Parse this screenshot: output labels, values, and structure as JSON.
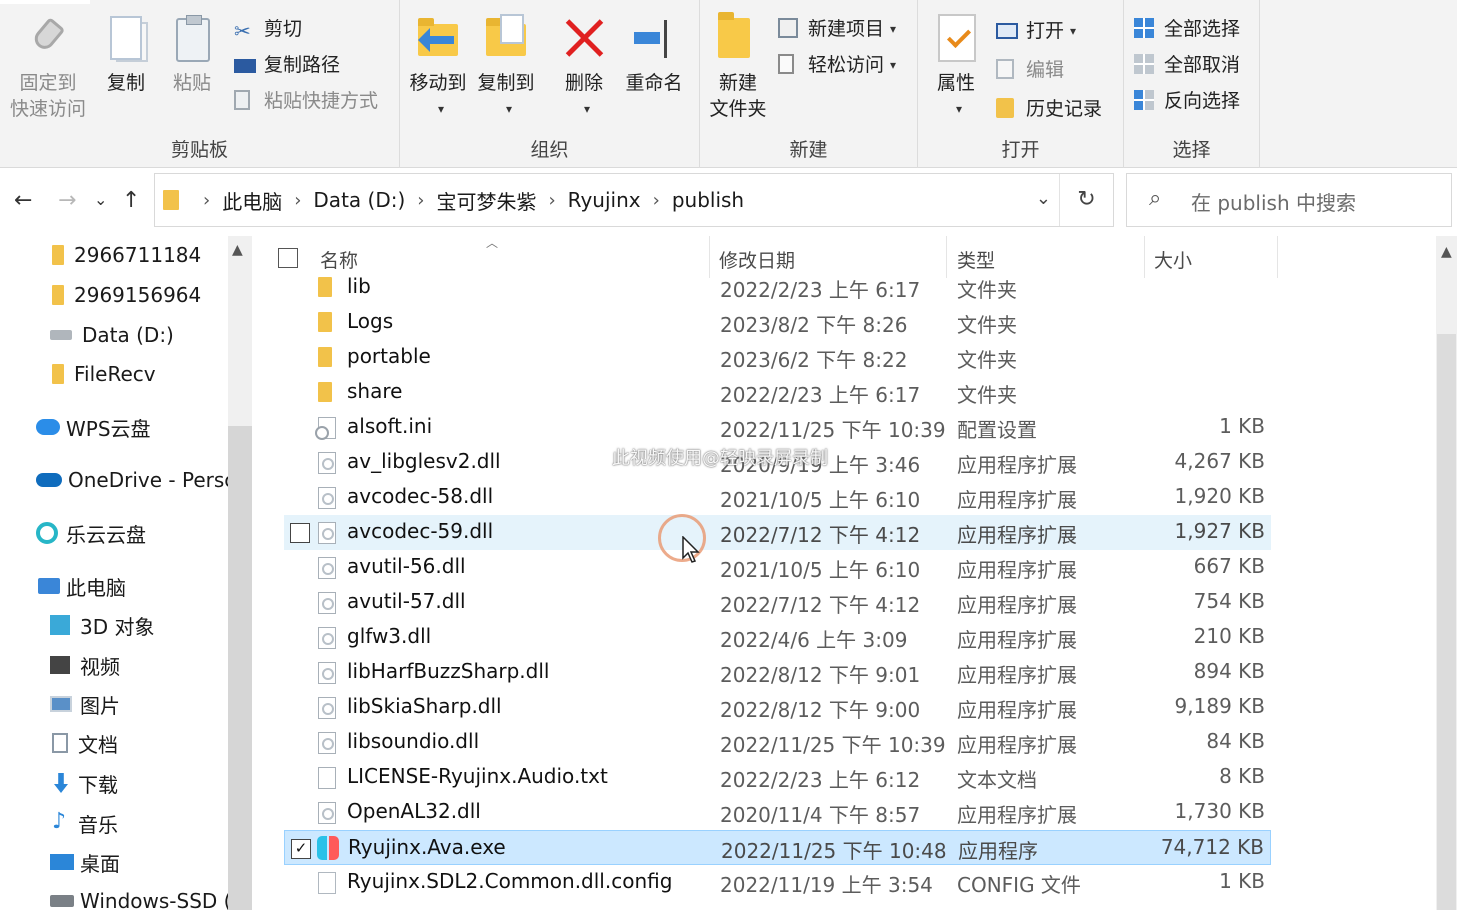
{
  "ribbon": {
    "clipboard": {
      "pin_label_1": "固定到",
      "pin_label_2": "快速访问",
      "copy": "复制",
      "paste": "粘贴",
      "cut": "剪切",
      "copy_path": "复制路径",
      "paste_shortcut": "粘贴快捷方式",
      "group": "剪贴板"
    },
    "organize": {
      "move_to": "移动到",
      "copy_to": "复制到",
      "delete": "删除",
      "rename": "重命名",
      "group": "组织"
    },
    "new": {
      "new_folder_1": "新建",
      "new_folder_2": "文件夹",
      "new_item": "新建项目",
      "easy_access": "轻松访问",
      "group": "新建"
    },
    "open": {
      "properties": "属性",
      "open": "打开",
      "edit": "编辑",
      "history": "历史记录",
      "group": "打开"
    },
    "select": {
      "select_all": "全部选择",
      "select_none": "全部取消",
      "invert": "反向选择",
      "group": "选择"
    }
  },
  "nav": {
    "back": "←",
    "forward": "→",
    "recent": "⌄",
    "up": "↑",
    "breadcrumbs": [
      "此电脑",
      "Data (D:)",
      "宝可梦朱紫",
      "Ryujinx",
      "publish"
    ],
    "refresh": "↻",
    "search_placeholder": "在 publish 中搜索"
  },
  "sidebar": {
    "items": [
      {
        "label": "2966711184",
        "icon": "folder-icon"
      },
      {
        "label": "2969156964",
        "icon": "folder-icon"
      },
      {
        "label": "Data (D:)",
        "icon": "drive-icon"
      },
      {
        "label": "FileRecv",
        "icon": "folder-icon"
      },
      {
        "label": "WPS云盘",
        "icon": "cloud-icon"
      },
      {
        "label": "OneDrive - Persc",
        "icon": "onedrive-icon"
      },
      {
        "label": "乐云云盘",
        "icon": "cloud-ring-icon"
      },
      {
        "label": "此电脑",
        "icon": "computer-icon"
      },
      {
        "label": "3D 对象",
        "icon": "cube-icon"
      },
      {
        "label": "视频",
        "icon": "video-icon"
      },
      {
        "label": "图片",
        "icon": "picture-icon"
      },
      {
        "label": "文档",
        "icon": "document-icon"
      },
      {
        "label": "下载",
        "icon": "download-icon"
      },
      {
        "label": "音乐",
        "icon": "music-icon"
      },
      {
        "label": "桌面",
        "icon": "desktop-icon"
      },
      {
        "label": "Windows-SSD (",
        "icon": "drive-icon"
      }
    ]
  },
  "columns": {
    "name": "名称",
    "date": "修改日期",
    "type": "类型",
    "size": "大小"
  },
  "files": [
    {
      "name": "lib",
      "date": "2022/2/23 上午 6:17",
      "type": "文件夹",
      "size": "",
      "kind": "folder"
    },
    {
      "name": "Logs",
      "date": "2023/8/2 下午 8:26",
      "type": "文件夹",
      "size": "",
      "kind": "folder"
    },
    {
      "name": "portable",
      "date": "2023/6/2 下午 8:22",
      "type": "文件夹",
      "size": "",
      "kind": "folder"
    },
    {
      "name": "share",
      "date": "2022/2/23 上午 6:17",
      "type": "文件夹",
      "size": "",
      "kind": "folder"
    },
    {
      "name": "alsoft.ini",
      "date": "2022/11/25 下午 10:39",
      "type": "配置设置",
      "size": "1 KB",
      "kind": "ini"
    },
    {
      "name": "av_libglesv2.dll",
      "date": "2020/9/19 上午 3:46",
      "type": "应用程序扩展",
      "size": "4,267 KB",
      "kind": "dll"
    },
    {
      "name": "avcodec-58.dll",
      "date": "2021/10/5 上午 6:10",
      "type": "应用程序扩展",
      "size": "1,920 KB",
      "kind": "dll"
    },
    {
      "name": "avcodec-59.dll",
      "date": "2022/7/12 下午 4:12",
      "type": "应用程序扩展",
      "size": "1,927 KB",
      "kind": "dll",
      "state": "hover"
    },
    {
      "name": "avutil-56.dll",
      "date": "2021/10/5 上午 6:10",
      "type": "应用程序扩展",
      "size": "667 KB",
      "kind": "dll"
    },
    {
      "name": "avutil-57.dll",
      "date": "2022/7/12 下午 4:12",
      "type": "应用程序扩展",
      "size": "754 KB",
      "kind": "dll"
    },
    {
      "name": "glfw3.dll",
      "date": "2022/4/6 上午 3:09",
      "type": "应用程序扩展",
      "size": "210 KB",
      "kind": "dll"
    },
    {
      "name": "libHarfBuzzSharp.dll",
      "date": "2022/8/12 下午 9:01",
      "type": "应用程序扩展",
      "size": "894 KB",
      "kind": "dll"
    },
    {
      "name": "libSkiaSharp.dll",
      "date": "2022/8/12 下午 9:00",
      "type": "应用程序扩展",
      "size": "9,189 KB",
      "kind": "dll"
    },
    {
      "name": "libsoundio.dll",
      "date": "2022/11/25 下午 10:39",
      "type": "应用程序扩展",
      "size": "84 KB",
      "kind": "dll"
    },
    {
      "name": "LICENSE-Ryujinx.Audio.txt",
      "date": "2022/2/23 上午 6:12",
      "type": "文本文档",
      "size": "8 KB",
      "kind": "txt"
    },
    {
      "name": "OpenAL32.dll",
      "date": "2020/11/4 下午 8:57",
      "type": "应用程序扩展",
      "size": "1,730 KB",
      "kind": "dll"
    },
    {
      "name": "Ryujinx.Ava.exe",
      "date": "2022/11/25 下午 10:48",
      "type": "应用程序",
      "size": "74,712 KB",
      "kind": "exe",
      "state": "selected"
    },
    {
      "name": "Ryujinx.SDL2.Common.dll.config",
      "date": "2022/11/19 上午 3:54",
      "type": "CONFIG 文件",
      "size": "1 KB",
      "kind": "cfg"
    }
  ],
  "overlay": {
    "watermark": "此视频使用@轻映录屏录制",
    "checkmark": "✓"
  },
  "colors": {
    "ribbon_bg": "#f3f3f3",
    "hover_row": "#e5f3fb",
    "selected_row": "#cce8ff",
    "folder": "#f2c24a",
    "accent": "#3a86d8"
  }
}
